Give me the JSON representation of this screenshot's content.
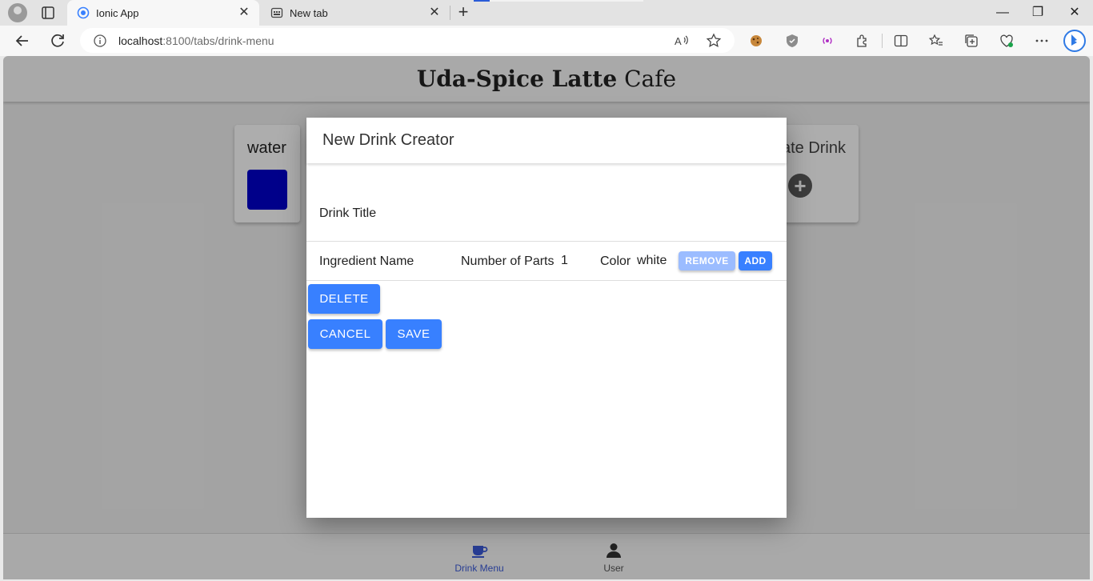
{
  "browser": {
    "tabs": [
      {
        "title": "Ionic App",
        "active": true
      },
      {
        "title": "New tab",
        "active": false
      }
    ],
    "url": {
      "host": "localhost",
      "rest": ":8100/tabs/drink-menu"
    }
  },
  "app": {
    "header": {
      "title_bold": "Uda-Spice Latte",
      "title_light": "Cafe"
    },
    "cards": [
      {
        "name": "water",
        "color": "#0000cc"
      },
      {
        "name": "Create Drink",
        "icon": "plus-circle-icon"
      }
    ],
    "tabbar": [
      {
        "label": "Drink Menu",
        "icon": "coffee-icon",
        "selected": true
      },
      {
        "label": "User",
        "icon": "person-icon",
        "selected": false
      }
    ]
  },
  "modal": {
    "title": "New Drink Creator",
    "drink_title_label": "Drink Title",
    "ingredient": {
      "name_label": "Ingredient Name",
      "parts_label": "Number of Parts",
      "parts_value": "1",
      "color_label": "Color",
      "color_value": "white",
      "remove_label": "REMOVE",
      "add_label": "ADD"
    },
    "delete_label": "DELETE",
    "cancel_label": "CANCEL",
    "save_label": "SAVE"
  }
}
